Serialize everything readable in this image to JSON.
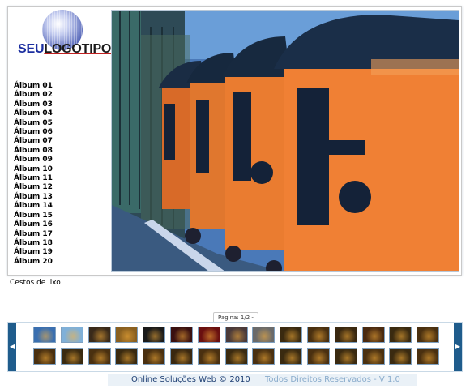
{
  "logo": {
    "seu": "SEU",
    "rest": "LOGOTIPO"
  },
  "albums": [
    "Álbum 01",
    "Álbum 02",
    "Álbum 03",
    "Álbum 04",
    "Álbum 05",
    "Álbum 06",
    "Álbum 07",
    "Álbum 08",
    "Álbum 09",
    "Álbum 10",
    "Álbum 11",
    "Álbum 12",
    "Álbum 13",
    "Álbum 14",
    "Álbum 15",
    "Álbum 16",
    "Álbum 17",
    "Álbum 18",
    "Álbum 19",
    "Álbum 20"
  ],
  "photo": {
    "icon": "dumpster-photo"
  },
  "caption": "Cestos de lixo",
  "pager": {
    "label": "Pagina: 1/2 -"
  },
  "nav": {
    "prev": "◀",
    "next": "▶"
  },
  "thumbnails": {
    "row1": [
      "#3a6fb0",
      "#7fb0d8",
      "#3a2a1a",
      "#8a6020",
      "#1a1a1a",
      "#3a1010",
      "#6a1010",
      "#4a3a3a",
      "#6a6a6a",
      "#3a2a10",
      "#4a3010",
      "#3a2810",
      "#4a2a10",
      "#3a2a10",
      "#4a3010"
    ],
    "row2": [
      "#4a3010",
      "#3a2a10",
      "#4a3010",
      "#3a2a10",
      "#4a3010",
      "#3a2810",
      "#4a3010",
      "#3a2a10",
      "#4a3010",
      "#3a2a10",
      "#4a3010",
      "#3a2a10",
      "#4a3010",
      "#3a2a10",
      "#4a3010"
    ]
  },
  "footer": {
    "left": "Online Soluções Web © 2010",
    "right": "Todos Direitos Reservados - V 1.0"
  }
}
